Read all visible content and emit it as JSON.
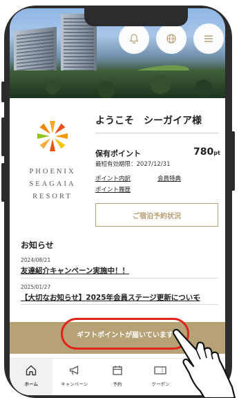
{
  "greeting": "ようこそ　シーガイア様",
  "logo": {
    "line1": "PHOENIX",
    "line2": "SEAGAIA",
    "line3": "RESORT"
  },
  "header_buttons": [
    {
      "icon": "bell-icon"
    },
    {
      "icon": "globe-icon"
    },
    {
      "icon": "menu-icon"
    }
  ],
  "points": {
    "label": "保有ポイント",
    "value": "780",
    "unit": "pt",
    "expiry": "最短有効期限：2027/12/31",
    "links": {
      "history_detail": "ポイント内訳",
      "member_benefits": "会員特典",
      "point_history": "ポイント履歴"
    }
  },
  "stay_button": "ご宿泊予約状況",
  "news": {
    "title": "お知らせ",
    "items": [
      {
        "date": "2024/08/21",
        "text": "友達紹介キャンペーン実施中！！"
      },
      {
        "date": "2025/01/27",
        "text": "【大切なお知らせ】2025年会員ステージ更新について"
      }
    ],
    "more": "…"
  },
  "gift_banner": "ギフトポイントが届いています",
  "tabs": [
    {
      "label": "ホーム",
      "icon": "home-icon",
      "active": true
    },
    {
      "label": "キャンペーン",
      "icon": "megaphone-icon",
      "active": false
    },
    {
      "label": "予約",
      "icon": "calendar-icon",
      "active": false
    },
    {
      "label": "クーポン",
      "icon": "coupon-icon",
      "active": false
    }
  ],
  "colors": {
    "gold": "#b7a278",
    "highlight": "#e2231a",
    "frame": "#2c2c2e"
  }
}
